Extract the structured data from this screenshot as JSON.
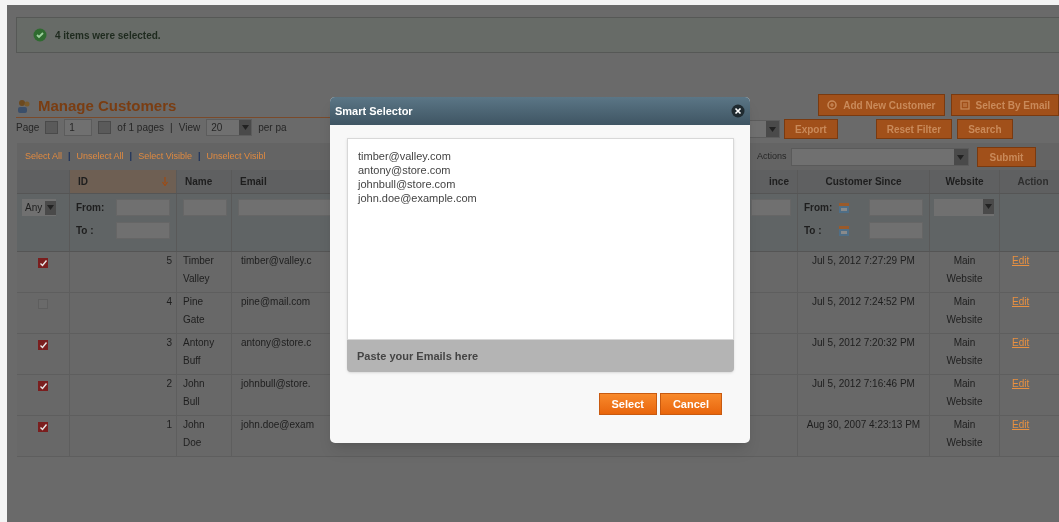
{
  "message": "4 items were selected.",
  "page_title": "Manage Customers",
  "header_buttons": [
    {
      "label": "Add New Customer",
      "kind": "add"
    },
    {
      "label": "Select By Email",
      "kind": "email"
    }
  ],
  "pager": [
    {
      "kind": "text",
      "text": "Page"
    },
    {
      "kind": "prev"
    },
    {
      "kind": "input",
      "text": "1"
    },
    {
      "kind": "next"
    },
    {
      "kind": "text",
      "text": "of 1 pages"
    },
    {
      "kind": "sep",
      "text": "|"
    },
    {
      "kind": "text",
      "text": "View"
    },
    {
      "kind": "select",
      "text": "20"
    },
    {
      "kind": "text",
      "text": "per pa"
    }
  ],
  "grid_buttons": [
    "Export",
    "Reset Filter",
    "Search"
  ],
  "mass_links": [
    {
      "kind": "link",
      "text": "Select All"
    },
    {
      "kind": "sep",
      "text": "|"
    },
    {
      "kind": "link",
      "text": "Unselect All"
    },
    {
      "kind": "sep",
      "text": "|"
    },
    {
      "kind": "link",
      "text": "Select Visible"
    },
    {
      "kind": "sep",
      "text": "|"
    },
    {
      "kind": "link",
      "text": "Unselect Visibl"
    }
  ],
  "actions_label": "Actions",
  "submit": "Submit",
  "columns": [
    {
      "label": "ID",
      "sorted": true
    },
    {
      "label": "Name",
      "sorted": false
    },
    {
      "label": "Email",
      "sorted": false
    },
    {
      "label": "ince",
      "sorted": false
    },
    {
      "label": "Customer Since",
      "sorted": false
    },
    {
      "label": "Website",
      "sorted": false
    },
    {
      "label": "Action",
      "sorted": false
    }
  ],
  "filters": {
    "any": "Any",
    "id_from": "From:",
    "id_to": "To :",
    "since_from": "From:",
    "since_to": "To :"
  },
  "rows": [
    {
      "checked": true,
      "id": "5",
      "name": "Timber Valley",
      "email": "timber@valley.c",
      "since": "Jul 5, 2012 7:27:29 PM",
      "website": "Main Website",
      "action": "Edit"
    },
    {
      "checked": false,
      "id": "4",
      "name": "Pine Gate",
      "email": "pine@mail.com",
      "since": "Jul 5, 2012 7:24:52 PM",
      "website": "Main Website",
      "action": "Edit"
    },
    {
      "checked": true,
      "id": "3",
      "name": "Antony Buff",
      "email": "antony@store.c",
      "since": "Jul 5, 2012 7:20:32 PM",
      "website": "Main Website",
      "action": "Edit"
    },
    {
      "checked": true,
      "id": "2",
      "name": "John Bull",
      "email": "johnbull@store.",
      "since": "Jul 5, 2012 7:16:46 PM",
      "website": "Main Website",
      "action": "Edit"
    },
    {
      "checked": true,
      "id": "1",
      "name": "John Doe",
      "email": "john.doe@exam",
      "since": "Aug 30, 2007 4:23:13 PM",
      "website": "Main Website",
      "action": "Edit"
    }
  ],
  "modal": {
    "title": "Smart Selector",
    "emails": [
      "timber@valley.com",
      "antony@store.com",
      "johnbull@store.com",
      "john.doe@example.com"
    ],
    "hint": "Paste your Emails here",
    "buttons": [
      "Select",
      "Cancel"
    ]
  }
}
